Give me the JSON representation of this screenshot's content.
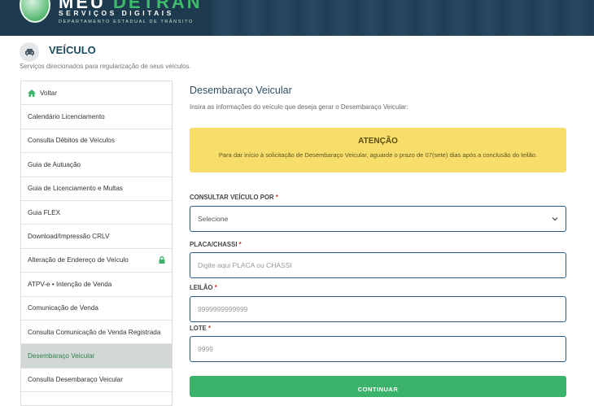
{
  "header": {
    "brand_part1": "MEU ",
    "brand_part2": "DETRAN",
    "subtitle": "SERVIÇOS DIGITAIS",
    "department": "DEPARTAMENTO ESTADUAL DE TRÂNSITO",
    "accent_color": "#3dbb6b",
    "bar_color": "#1d3a4f"
  },
  "section": {
    "icon": "car-icon",
    "title": "VEÍCULO",
    "description": "Serviços direcionados para regularização de seus veículos."
  },
  "sidebar": {
    "items": [
      {
        "label": "Voltar",
        "icon": "home-icon"
      },
      {
        "label": "Calendário Licenciamento"
      },
      {
        "label": "Consulta Débitos de Veículos"
      },
      {
        "label": "Guia de Autuação"
      },
      {
        "label": "Guia de Licenciamento e Multas"
      },
      {
        "label": "Guia FLEX"
      },
      {
        "label": "Download/Impressão CRLV"
      },
      {
        "label": "Alteração de Endereço de Veículo",
        "icon": "lock-icon"
      },
      {
        "label": "ATPV-e • Intenção de Venda"
      },
      {
        "label": "Comunicação de Venda"
      },
      {
        "label": "Consulta Comunicação de Venda Registrada"
      },
      {
        "label": "Desembaraço Veicular",
        "active": true
      },
      {
        "label": "Consulta Desembaraço Veicular"
      }
    ]
  },
  "main": {
    "title": "Desembaraço Veicular",
    "subtitle": "Insira as informações do veículo que deseja gerar o Desembaraço Veicular:",
    "alert": {
      "title": "ATENÇÃO",
      "text": "Para dar início à solicitação de Desembaraço Veicular, aguarde o prazo de 07(sete) dias após a conclusão do leilão.",
      "color": "#f7de6a"
    },
    "form": {
      "consultar_label": "CONSULTAR VEÍCULO POR",
      "consultar_selected": "Selecione",
      "placa_label": "PLACA/CHASSI",
      "placa_placeholder": "Digite aqui PLACA ou CHASSI",
      "leilao_label": "LEILÃO",
      "leilao_placeholder": "9999999999999",
      "lote_label": "LOTE",
      "lote_placeholder": "9999",
      "required_mark": "*"
    },
    "button_label": "CONTINUAR",
    "button_color": "#3bb36b"
  }
}
